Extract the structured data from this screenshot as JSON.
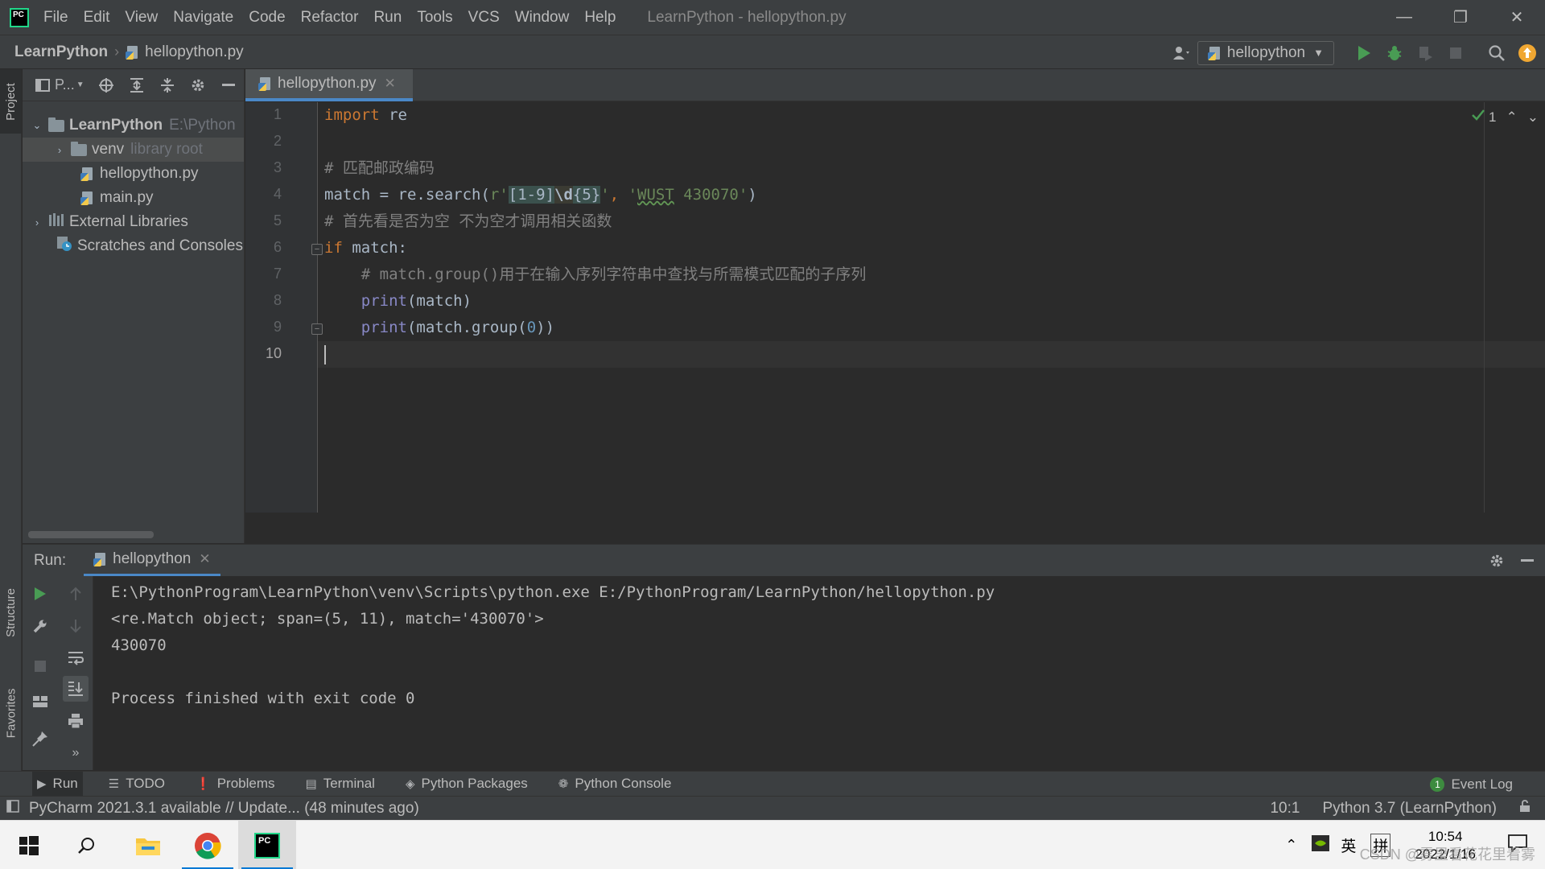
{
  "titlebar": {
    "menu": [
      "File",
      "Edit",
      "View",
      "Navigate",
      "Code",
      "Refactor",
      "Run",
      "Tools",
      "VCS",
      "Window",
      "Help"
    ],
    "window_title": "LearnPython - hellopython.py"
  },
  "navbar": {
    "project": "LearnPython",
    "file": "hellopython.py",
    "run_config": "hellopython"
  },
  "left_stripe": {
    "project_tab": "Project",
    "structure_tab": "Structure",
    "favorites_tab": "Favorites"
  },
  "project_panel": {
    "toolbar_label": "P...",
    "tree": [
      {
        "name": "LearnPython",
        "hint": "E:\\Python"
      },
      {
        "name": "venv",
        "hint": "library root"
      },
      {
        "name": "hellopython.py"
      },
      {
        "name": "main.py"
      },
      {
        "name": "External Libraries"
      },
      {
        "name": "Scratches and Consoles"
      }
    ]
  },
  "editor": {
    "tab": "hellopython.py",
    "line_numbers": [
      "1",
      "2",
      "3",
      "4",
      "5",
      "6",
      "7",
      "8",
      "9",
      "10"
    ],
    "code": {
      "l1_kw": "import",
      "l1_rest": " re",
      "l3": "# 匹配邮政编码",
      "l4_a": "match = re.search(",
      "l4_prefix": "r'",
      "l4_rx1": "[1-9]",
      "l4_rx2": "\\d",
      "l4_rx3": "{5}",
      "l4_q": "'",
      "l4_comma": ", ",
      "l4_s1": "'",
      "l4_s2": "WUST",
      "l4_s3": " 430070'",
      "l4_end": ")",
      "l5": "# 首先看是否为空 不为空才调用相关函数",
      "l6_kw": "if",
      "l6_rest": " match:",
      "l7": "    # match.group()用于在输入序列字符串中查找与所需模式匹配的子序列",
      "l8_indent": "    ",
      "l8_fn": "print",
      "l8_rest": "(match)",
      "l9_indent": "    ",
      "l9_fn": "print",
      "l9_a": "(match.group(",
      "l9_num": "0",
      "l9_b": "))"
    },
    "inspections": "1"
  },
  "run_panel": {
    "label": "Run:",
    "tab": "hellopython",
    "console": [
      "E:\\PythonProgram\\LearnPython\\venv\\Scripts\\python.exe E:/PythonProgram/LearnPython/hellopython.py",
      "<re.Match object; span=(5, 11), match='430070'>",
      "430070",
      "",
      "Process finished with exit code 0"
    ]
  },
  "bottom_tools": {
    "run": "Run",
    "todo": "TODO",
    "problems": "Problems",
    "terminal": "Terminal",
    "packages": "Python Packages",
    "console": "Python Console",
    "event_log": "Event Log",
    "event_count": "1"
  },
  "statusbar": {
    "message": "PyCharm 2021.3.1 available // Update... (48 minutes ago)",
    "position": "10:1",
    "interpreter": "Python 3.7 (LearnPython)"
  },
  "taskbar": {
    "ime_lang": "英",
    "ime_mode": "拼",
    "time": "10:54",
    "date": "2022/1/16",
    "watermark": "CSDN @雾里看花花里看雾"
  },
  "colors": {
    "accent": "#4a88c7",
    "run_green": "#499c54",
    "keyword": "#cc7832",
    "string": "#6a8759",
    "comment": "#808080"
  }
}
